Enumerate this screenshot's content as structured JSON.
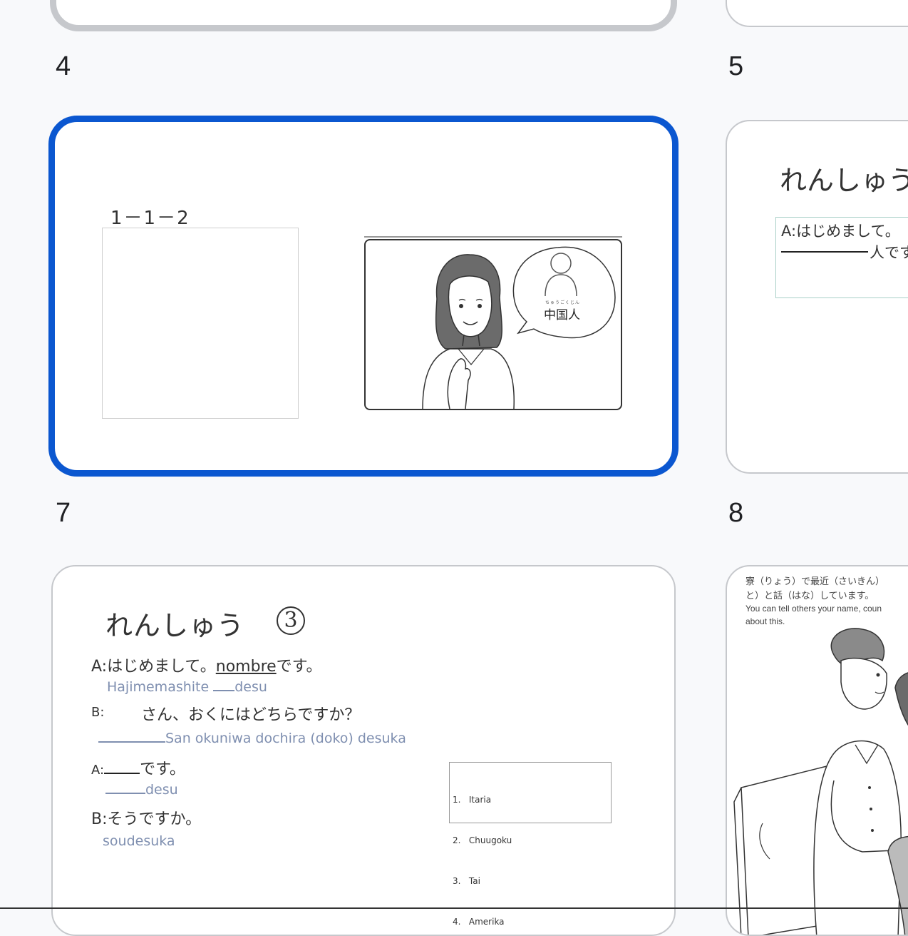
{
  "slides": [
    {
      "number": "4",
      "selected": true,
      "label": "1－1－2",
      "illustration_caption": "中国人",
      "illustration_ruby": "ちゅうごくじん"
    },
    {
      "number": "5",
      "title": "れんしゅう",
      "line1": "A:はじめまして。",
      "line2": "人です"
    },
    {
      "number": "7",
      "title": "れんしゅう",
      "circle_num": "3",
      "a1_prefix": "A:はじめまして。",
      "a1_word": "nombre",
      "a1_suffix": "です。",
      "a1_roma_pre": "Hajimemashite",
      "a1_roma_post": "desu",
      "b1_label": "B:",
      "b1_text": "さん、おくにはどちらですか？",
      "b1_roma": "San okuniwa dochira (doko) desuka",
      "a2_label": "A:",
      "a2_text": "です。",
      "a2_roma": "desu",
      "b2_text": "B:そうですか。",
      "b2_roma": "soudesuka",
      "options": [
        "1.   Itaria",
        "2.   Chuugoku",
        "3.   Tai",
        "4.   Amerika"
      ]
    },
    {
      "number": "8",
      "jp_line1": "寮（りょう）で最近（さいきん）",
      "jp_line2": "と）と話（はな）しています。",
      "en_line1": "You can tell others your name, coun",
      "en_line2": "about this."
    }
  ]
}
